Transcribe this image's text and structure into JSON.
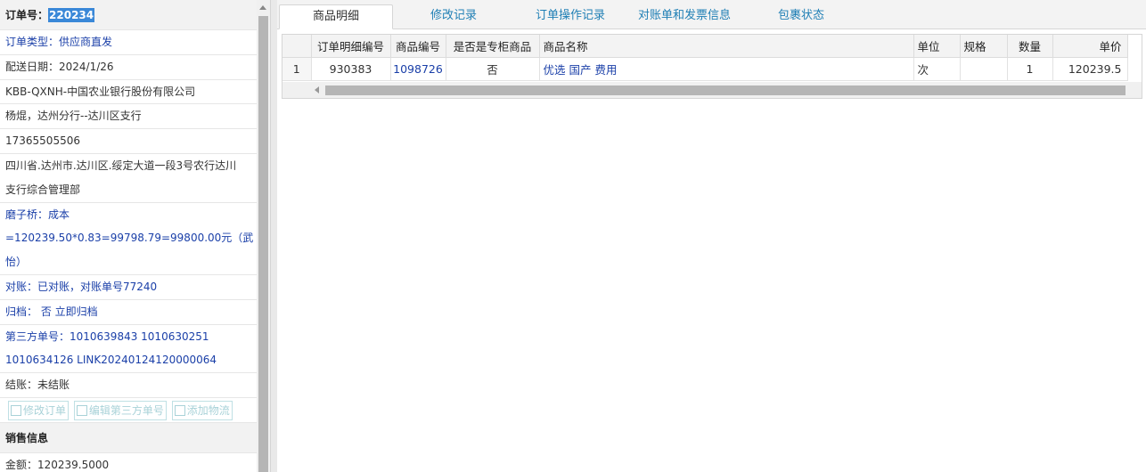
{
  "order": {
    "label": "订单号：",
    "number": "220234",
    "type": "订单类型：供应商直发",
    "delivery_date": "配送日期：2024/1/26",
    "company": "KBB-QXNH-中国农业银行股份有限公司",
    "contact": "杨焜，达州分行--达川区支行",
    "phone": "17365505506",
    "address_line1": "四川省.达州市.达川区.绥定大道一段3号农行达川",
    "address_line2": "支行综合管理部",
    "note_line1": "磨子桥：成本",
    "note_line2": "=120239.50*0.83=99798.79=99800.00元（武",
    "note_line3": "怡）",
    "reconcile": "对账：已对账，对账单号77240",
    "archive": "归档： 否 立即归档",
    "third_party_line1": "第三方单号：1010639843 1010630251",
    "third_party_line2": "1010634126 LINK20240124120000064",
    "settlement": "结账：未结账"
  },
  "actions": {
    "modify_order": "修改订单",
    "edit_third_party": "编辑第三方单号",
    "add_logistics": "添加物流"
  },
  "sales": {
    "title": "销售信息",
    "amount": "金额：120239.5000"
  },
  "tabs": [
    "商品明细",
    "修改记录",
    "订单操作记录",
    "对账单和发票信息",
    "包裹状态"
  ],
  "grid": {
    "headers": [
      "订单明细编号",
      "商品编号",
      "是否是专柜商品",
      "商品名称",
      "单位",
      "规格",
      "数量",
      "单价"
    ],
    "rows": [
      {
        "index": "1",
        "detail_no": "930383",
        "product_no": "1098726",
        "counter_product": "否",
        "product_name": "优选 国产 费用",
        "unit": "次",
        "spec": "",
        "quantity": "1",
        "price": "120239.5"
      }
    ]
  },
  "colors": {
    "accent": "#1f7fb5",
    "link": "#1a3fa8",
    "highlight": "#3a88d8"
  }
}
